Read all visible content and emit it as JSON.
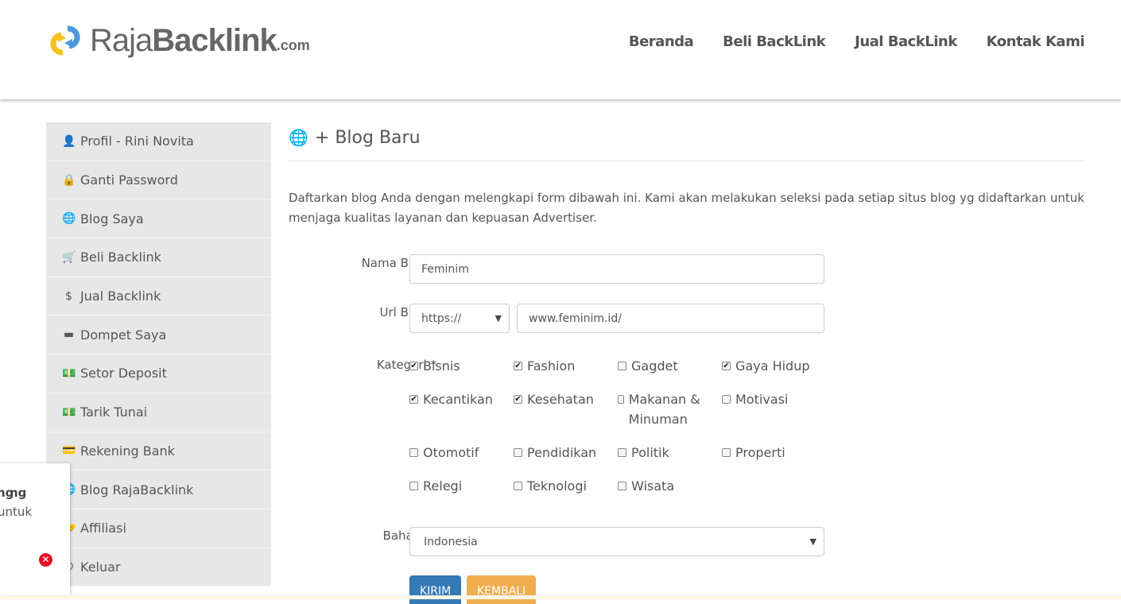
{
  "header": {
    "logo": {
      "raja": "Raja",
      "backlink": "Backlink",
      "com": ".com"
    },
    "nav": [
      "Beranda",
      "Beli BackLink",
      "Jual BackLink",
      "Kontak Kami"
    ]
  },
  "sidebar": {
    "items": [
      {
        "icon": "user-icon",
        "glyph": "👤",
        "label": "Profil - Rini Novita"
      },
      {
        "icon": "user-lock-icon",
        "glyph": "🔒",
        "label": "Ganti Password"
      },
      {
        "icon": "globe-icon",
        "glyph": "🌐",
        "label": "Blog Saya"
      },
      {
        "icon": "cart-icon",
        "glyph": "🛒",
        "label": "Beli Backlink"
      },
      {
        "icon": "hand-dollar-icon",
        "glyph": "$",
        "label": "Jual Backlink"
      },
      {
        "icon": "wallet-icon",
        "glyph": "▬",
        "label": "Dompet Saya"
      },
      {
        "icon": "money-icon",
        "glyph": "💵",
        "label": "Setor Deposit"
      },
      {
        "icon": "money-icon",
        "glyph": "💵",
        "label": "Tarik Tunai"
      },
      {
        "icon": "credit-card-icon",
        "glyph": "💳",
        "label": "Rekening Bank"
      },
      {
        "icon": "globe-icon",
        "glyph": "🌐",
        "label": "Blog RajaBacklink"
      },
      {
        "icon": "handshake-icon",
        "glyph": "🤝",
        "label": "Affiliasi"
      },
      {
        "icon": "power-icon",
        "glyph": "⏻",
        "label": "Keluar"
      }
    ]
  },
  "main": {
    "title": "+ Blog Baru",
    "intro": "Daftarkan blog Anda dengan melengkapi form dibawah ini. Kami akan melakukan seleksi pada setiap situs blog yg didaftarkan untuk menjaga kualitas layanan dan kepuasan Advertiser.",
    "form": {
      "nama_label": "Nama Blog *",
      "nama_value": "Feminim",
      "url_label": "Url Blog *",
      "protocol": "https://",
      "url_value": "www.feminim.id/",
      "kategori_label": "Kategori *",
      "kategori": [
        {
          "label": "Bisnis",
          "checked": true
        },
        {
          "label": "Fashion",
          "checked": true
        },
        {
          "label": "Gagdet",
          "checked": false
        },
        {
          "label": "Gaya Hidup",
          "checked": true
        },
        {
          "label": "Kecantikan",
          "checked": true
        },
        {
          "label": "Kesehatan",
          "checked": true
        },
        {
          "label": "Makanan & Minuman",
          "checked": false
        },
        {
          "label": "Motivasi",
          "checked": false
        },
        {
          "label": "Otomotif",
          "checked": false
        },
        {
          "label": "Pendidikan",
          "checked": false
        },
        {
          "label": "Politik",
          "checked": false
        },
        {
          "label": "Properti",
          "checked": false
        },
        {
          "label": "Relegi",
          "checked": false
        },
        {
          "label": "Teknologi",
          "checked": false
        },
        {
          "label": "Wisata",
          "checked": false
        }
      ],
      "bahasa_label": "Bahasa *",
      "bahasa_value": "Indonesia",
      "submit": "KIRIM",
      "back": "KEMBALI"
    }
  },
  "toast": {
    "line1": "ng",
    "line2": "untuk"
  },
  "colors": {
    "primary": "#337ab7",
    "warning": "#f0ad4e",
    "sidebar": "#e7e7e7",
    "error": "#e3102a"
  }
}
